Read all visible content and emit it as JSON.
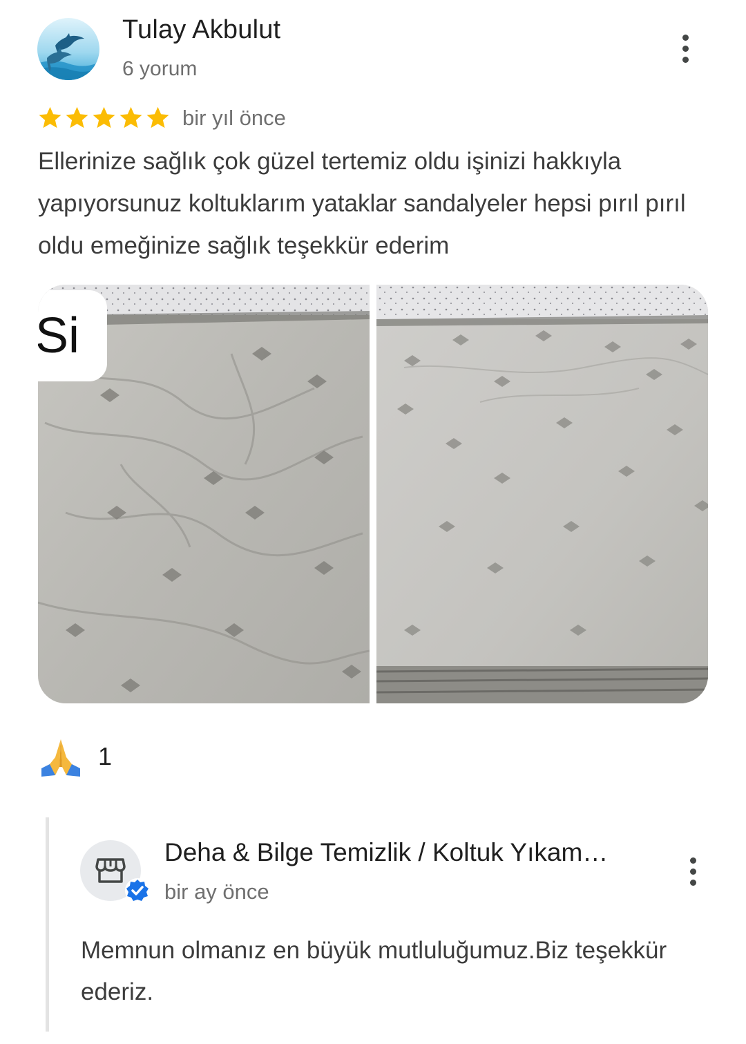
{
  "review": {
    "reviewer_name": "Tulay Akbulut",
    "review_count": "6 yorum",
    "rating": 5,
    "max_rating": 5,
    "time": "bir yıl önce",
    "text": "Ellerinize sağlık çok güzel tertemiz oldu işinizi hakkıyla yapıyorsunuz koltuklarım yataklar sandalyeler hepsi pırıl pırıl oldu emeğinize sağlık teşekkür ederim",
    "photo_badge_text": "Si",
    "reaction_count": "1"
  },
  "reply": {
    "owner_name": "Deha & Bilge Temizlik / Koltuk Yıkam…",
    "time": "bir ay önce",
    "text": "Memnun olmanız en büyük mutluluğumuz.Biz teşekkür ederiz."
  },
  "colors": {
    "star": "#fbbc04",
    "secondary_text": "#6f6f6f",
    "verified": "#1a73e8"
  },
  "icons": {
    "more": "more-vert-icon",
    "star": "star-icon",
    "reaction": "folded-hands-icon",
    "store": "storefront-icon",
    "verified": "verified-badge-icon"
  }
}
